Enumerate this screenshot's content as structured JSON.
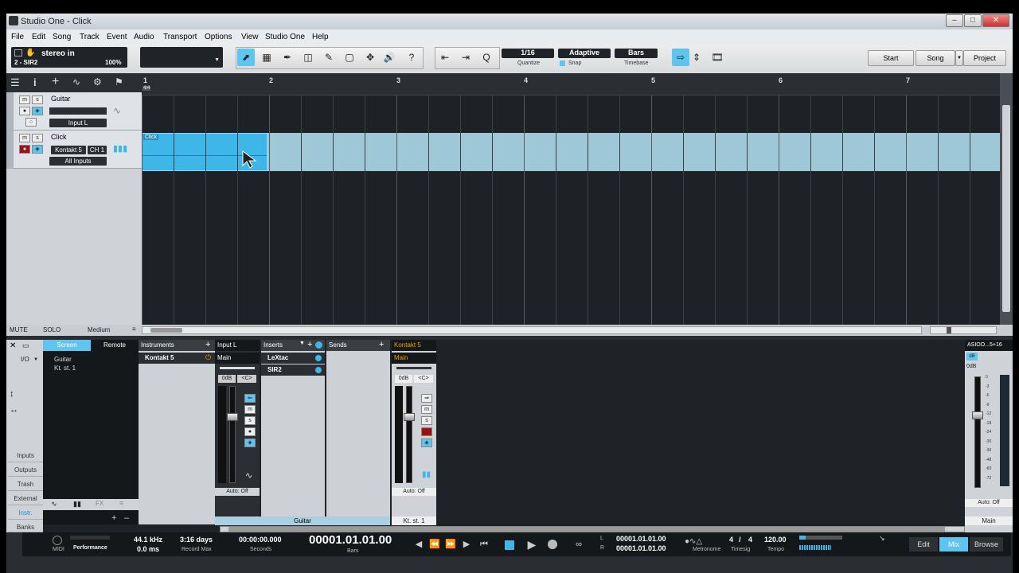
{
  "window": {
    "title": "Studio One - Click",
    "min": "–",
    "max": "□",
    "close": "✕"
  },
  "menu": [
    "File",
    "Edit",
    "Song",
    "Track",
    "Event",
    "Audio",
    "Transport",
    "Options",
    "View",
    "Studio One",
    "Help"
  ],
  "toolbar": {
    "track_name": "stereo in",
    "track_sub": "2 - SIR2",
    "zoom": "100%",
    "quantize_value": "1/16",
    "quantize_label": "Quantize",
    "snap_value": "Adaptive",
    "snap_label": "Snap",
    "timebase_value": "Bars",
    "timebase_label": "Timebase",
    "start": "Start",
    "song": "Song",
    "project": "Project"
  },
  "tracks": [
    {
      "name": "Guitar",
      "m": "m",
      "s": "s",
      "input": "Input L"
    },
    {
      "name": "Click",
      "m": "m",
      "s": "s",
      "instrument": "Kontakt 5",
      "channel": "CH 1",
      "input": "All Inputs"
    }
  ],
  "ruler": {
    "numbers": [
      "1",
      "2",
      "3",
      "4",
      "5",
      "6",
      "7"
    ],
    "signature": "4/4"
  },
  "clip": {
    "label": "Click"
  },
  "status_row": {
    "mute": "MUTE",
    "solo": "SOLO",
    "size": "Medium"
  },
  "console": {
    "tabs": {
      "screen": "Screen",
      "remote": "Remote"
    },
    "io": "I/O",
    "tree": [
      "Guitar",
      "Kt. st. 1"
    ],
    "side_buttons": [
      "Inputs",
      "Outputs",
      "Trash",
      "External",
      "Instr.",
      "Banks"
    ],
    "instruments_header": "Instruments",
    "instrument_item": "Kontakt 5",
    "ch1": {
      "header": "Input L",
      "route": "Main",
      "gain": "0dB",
      "pan": "<C>",
      "auto": "Auto: Off",
      "name": "Guitar"
    },
    "inserts_header": "Inserts",
    "inserts": [
      "LeXtac",
      "SIR2"
    ],
    "sends_header": "Sends",
    "ch2": {
      "header": "Kontakt 5",
      "route": "Main",
      "gain": "0dB",
      "pan": "<C>",
      "auto": "Auto: Off",
      "name": "Kt. st. 1"
    },
    "master": {
      "header": "ASIOO...5+16",
      "gain": "0dB",
      "auto": "Auto: Off",
      "name": "Main",
      "scale": [
        "0",
        "-3",
        "-6",
        "-9",
        "-12",
        "-18",
        "-24",
        "-30",
        "-36",
        "-48",
        "-60",
        "-72"
      ]
    },
    "fader_labels": {
      "m": "m",
      "s": "s"
    }
  },
  "transport": {
    "midi": "MIDI",
    "performance": "Performance",
    "samplerate": "44.1 kHz",
    "latency": "0.0 ms",
    "record_max_value": "3:16 days",
    "record_max": "Record Max",
    "seconds_value": "00:00:00.000",
    "seconds": "Seconds",
    "bars_value": "00001.01.01.00",
    "bars": "Bars",
    "loop_l": "00001.01.01.00",
    "loop_r": "00001.01.01.00",
    "loop_l_label": "L",
    "loop_r_label": "R",
    "metronome": "Metronome",
    "timesig_num": "4",
    "timesig_slash": "/",
    "timesig_den": "4",
    "timesig": "Timesig",
    "tempo_value": "120.00",
    "tempo": "Tempo",
    "edit": "Edit",
    "mix": "Mix",
    "browse": "Browse"
  },
  "colors": {
    "accent": "#3fb6e8",
    "record": "#a01010",
    "panel": "#1f2226"
  }
}
